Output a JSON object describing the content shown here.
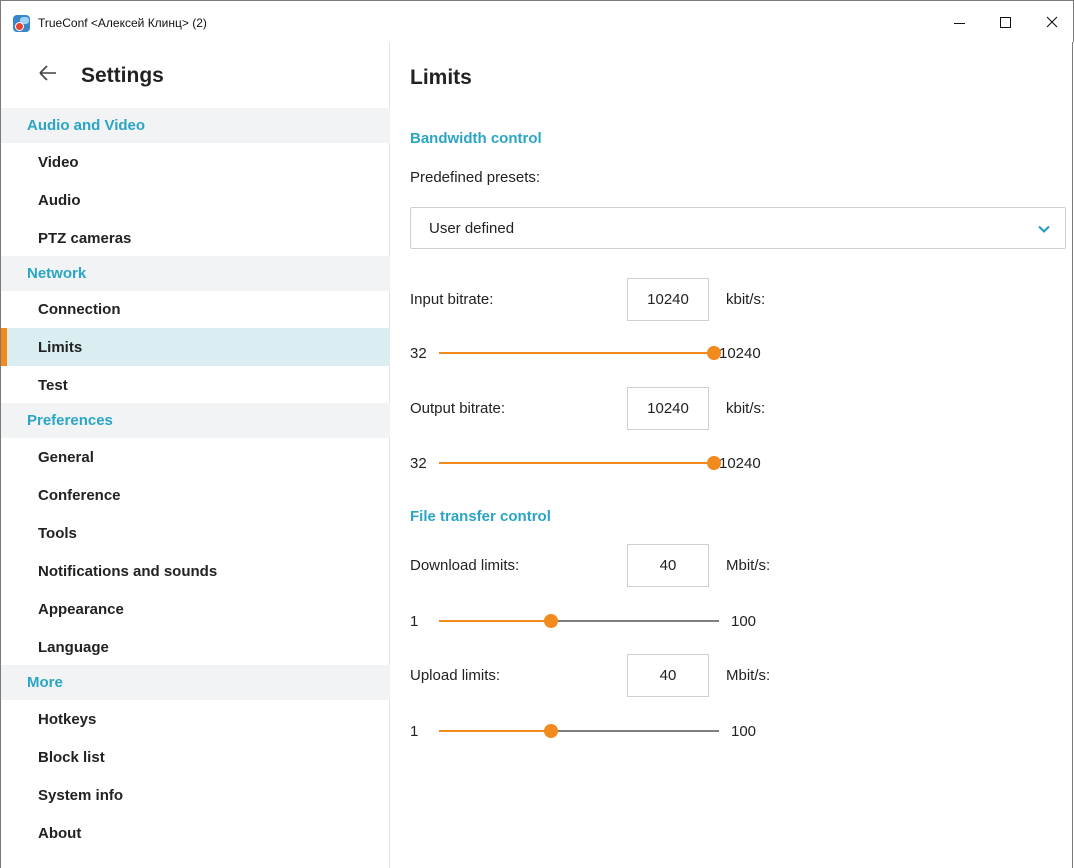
{
  "window": {
    "title": "TrueConf <Алексей Клинц> (2)",
    "controls": {
      "close_glyph": "✕"
    }
  },
  "sidebar": {
    "title": "Settings",
    "sections": [
      {
        "label": "Audio and Video",
        "items": [
          "Video",
          "Audio",
          "PTZ cameras"
        ]
      },
      {
        "label": "Network",
        "items": [
          "Connection",
          "Limits",
          "Test"
        ]
      },
      {
        "label": "Preferences",
        "items": [
          "General",
          "Conference",
          "Tools",
          "Notifications and sounds",
          "Appearance",
          "Language"
        ]
      },
      {
        "label": "More",
        "items": [
          "Hotkeys",
          "Block list",
          "System info",
          "About"
        ]
      }
    ],
    "active_item": "Limits"
  },
  "main": {
    "title": "Limits",
    "bandwidth": {
      "heading": "Bandwidth control",
      "presets_label": "Predefined presets:",
      "preset_value": "User defined",
      "input": {
        "label": "Input bitrate:",
        "value": "10240",
        "unit": "kbit/s:",
        "min": "32",
        "max": "10240",
        "fraction": 1.0
      },
      "output": {
        "label": "Output bitrate:",
        "value": "10240",
        "unit": "kbit/s:",
        "min": "32",
        "max": "10240",
        "fraction": 1.0
      }
    },
    "file_transfer": {
      "heading": "File transfer control",
      "download": {
        "label": "Download limits:",
        "value": "40",
        "unit": "Mbit/s:",
        "min": "1",
        "max": "100",
        "fraction": 0.4
      },
      "upload": {
        "label": "Upload limits:",
        "value": "40",
        "unit": "Mbit/s:",
        "min": "1",
        "max": "100",
        "fraction": 0.4
      }
    }
  },
  "colors": {
    "accent": "#2aa6c4",
    "slider": "#f28a1e",
    "active_bg": "#daeef2"
  }
}
